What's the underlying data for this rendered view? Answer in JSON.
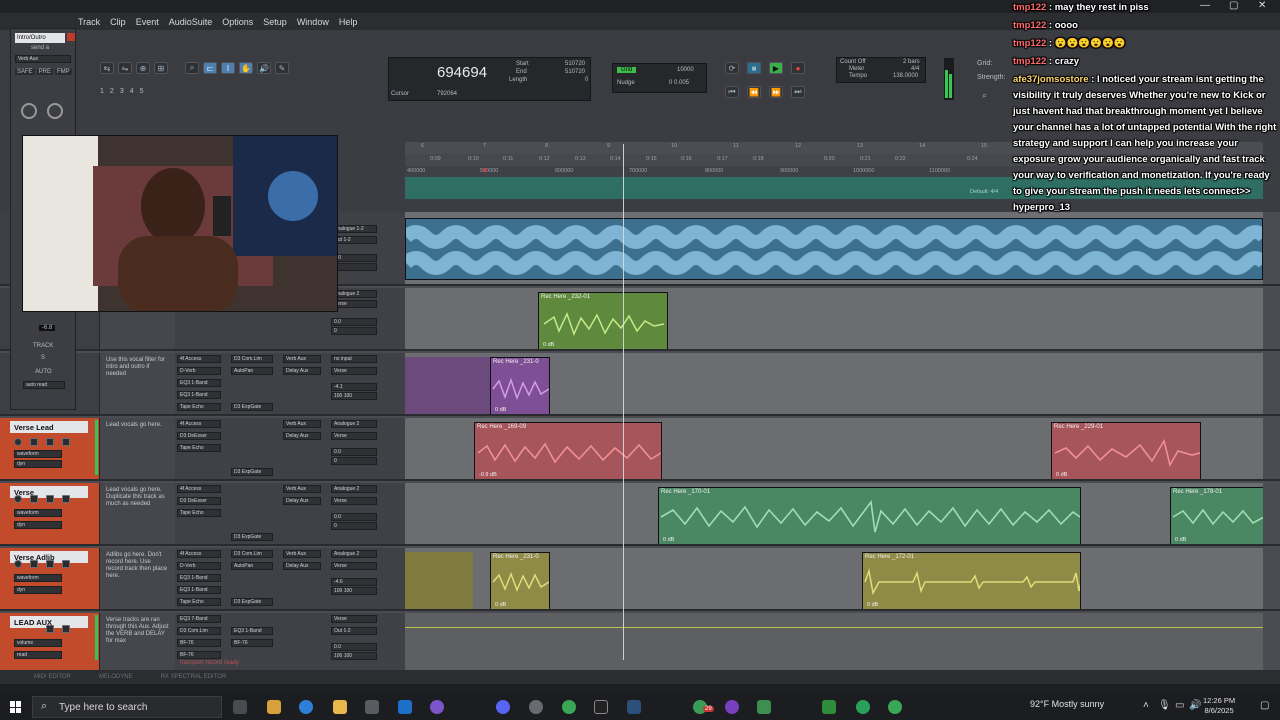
{
  "menu": {
    "items": [
      "Track",
      "Clip",
      "Event",
      "AudioSuite",
      "Options",
      "Setup",
      "Window",
      "Help"
    ]
  },
  "transport": {
    "counter": "694694",
    "start_label": "Start",
    "start_value": "510720",
    "end_label": "End",
    "end_value": "510720",
    "length_label": "Length",
    "length_value": "0",
    "cursor_label": "Cursor",
    "cursor_value": "792064",
    "grid_label": "Grid",
    "grid_value": "10000",
    "nudge_label": "Nudge",
    "nudge_value": "0 0.005",
    "count_off": "Count Off",
    "count_bars": "2 bars",
    "meter_label": "Meter",
    "meter_value": "4/4",
    "tempo_label": "Tempo",
    "tempo_value": "138.0000",
    "grid_right_label": "Grid:",
    "strength_label": "Strength:"
  },
  "ruler": {
    "bars": [
      "6",
      "7",
      "8",
      "9",
      "10",
      "11",
      "12",
      "13",
      "14",
      "15"
    ],
    "times": [
      "0:09",
      "0:10",
      "0:11",
      "0:12",
      "0:13",
      "0:14",
      "0:15",
      "0:16",
      "0:17",
      "0:18",
      "0:20",
      "0:21",
      "0:22",
      "0:24"
    ],
    "samples": [
      "400000",
      "500000",
      "600000",
      "700000",
      "800000",
      "900000",
      "1000000",
      "1100000"
    ],
    "meter_marker": "Default: 4/4"
  },
  "webcam": {
    "description_label": ""
  },
  "mixer_strip": {
    "name": "Intro/Outro",
    "send": "send a",
    "verb": "Verb Aux",
    "safe": "SAFE",
    "pre": "PRE",
    "fmp": "FMP",
    "db": "-6.8",
    "track_label": "TRACK",
    "s_label": "S",
    "auto_label": "AUTO",
    "auto_mode": "auto read"
  },
  "tracks": [
    {
      "name": "",
      "comment": "",
      "vol": "0.0",
      "pan": "0",
      "in": "Analogue 1-2",
      "out": "Out 1-2"
    },
    {
      "name": "",
      "comment": "section you are working on.",
      "vol": "0.0",
      "pan": "0",
      "in": "Analogue 2",
      "out": "Verse"
    },
    {
      "name": "",
      "comment": "Use this vocal filter for intro and outro if needed",
      "vol": "-4.1",
      "pan": "100 100",
      "in": "no input",
      "out": "Verse",
      "plugins": [
        "4f Access",
        "D-Verb",
        "EQ3 1-Band",
        "EQ3 1-Band",
        "Tape Echo"
      ],
      "plugins2": [
        "D3 Com.Lim",
        "AutoPan",
        "",
        "",
        "D3 ExpGate"
      ],
      "sends": [
        "Verb Aux",
        "Delay Aux"
      ]
    },
    {
      "name": "Verse Lead",
      "comment": "Lead vocals go here.",
      "vol": "0.0",
      "pan": "0",
      "in": "Analogue 2",
      "out": "Verse",
      "plugins": [
        "4f Access",
        "D3 DeEsser",
        "Tape Echo",
        "",
        ""
      ],
      "plugins2": [
        "",
        "",
        "",
        "",
        "D3 ExpGate"
      ],
      "sends": [
        "Verb Aux",
        "Delay Aux"
      ],
      "view": "waveform",
      "dyn": "dyn",
      "mode": "read"
    },
    {
      "name": "Verse",
      "comment": "Lead vocals go here. Duplicate this track as much as needed",
      "vol": "0.0",
      "pan": "0",
      "in": "Analogue 2",
      "out": "Verse",
      "plugins": [
        "4f Access",
        "D3 DeEsser",
        "Tape Echo",
        "",
        ""
      ],
      "plugins2": [
        "",
        "",
        "",
        "",
        "D3 ExpGate"
      ],
      "sends": [
        "Verb Aux",
        "Delay Aux"
      ],
      "view": "waveform",
      "dyn": "dyn",
      "mode": "read"
    },
    {
      "name": "Verse Adlib",
      "comment": "Adlibs go here. Don't record here. Use record track then place here.",
      "vol": "-4.6",
      "pan": "100 100",
      "in": "Analogue 2",
      "out": "Verse",
      "plugins": [
        "4f Access",
        "D-Verb",
        "EQ3 1-Band",
        "EQ3 1-Band",
        "Tape Echo"
      ],
      "plugins2": [
        "D3 Com.Lim",
        "AutoPan",
        "",
        "",
        "D3 ExpGate"
      ],
      "sends": [
        "Verb Aux",
        "Delay Aux"
      ],
      "view": "waveform",
      "dyn": "dyn",
      "mode": "read"
    },
    {
      "name": "LEAD AUX",
      "comment": "Verse tracks are ran through this Aux. Adjust the VERB and DELAY for max",
      "vol": "0.0",
      "pan": "100 100",
      "in": "Verse",
      "out": "Out 1-2",
      "plugins": [
        "EQ3 7-Band",
        "D3 Com.Lim",
        "BF-76",
        "BF-76",
        ""
      ],
      "plugins2": [
        "",
        "EQ3 1-Band",
        "BF-76",
        "",
        ""
      ],
      "sends": [],
      "view": "volume",
      "dyn": "",
      "mode": "read"
    }
  ],
  "clips": [
    {
      "label": "Rec Here _232-01",
      "db": "0 dB",
      "color": "#78a44f",
      "wave": "#c7e88b"
    },
    {
      "label": "Rec Here _231-0",
      "db": "0 dB",
      "color": "#8a4fa0",
      "wave": "#d39be6"
    },
    {
      "label": "Rec Here _169-09",
      "db": "-0.9 dB",
      "color": "#b35a5f",
      "wave": "#f08f95"
    },
    {
      "label": "Rec Here _229-01",
      "db": "0 dB",
      "color": "#b35a5f",
      "wave": "#f08f95"
    },
    {
      "label": "Rec Here _170-01",
      "db": "0 dB",
      "color": "#4f8f68",
      "wave": "#9be0b3"
    },
    {
      "label": "Rec Here _178-01",
      "db": "0 dB",
      "color": "#4f8f68",
      "wave": "#9be0b3"
    },
    {
      "label": "Rec Here _231-0",
      "db": "0 dB",
      "color": "#8f8a45",
      "wave": "#e2dc7c"
    },
    {
      "label": "Rec Here _172-01",
      "db": "0 dB",
      "color": "#8f8a45",
      "wave": "#e2dc7c"
    }
  ],
  "chat": [
    {
      "user": "tmp122",
      "text": "may they rest in piss"
    },
    {
      "user": "tmp122",
      "text": "oooo"
    },
    {
      "user": "tmp122",
      "text": "😮😮😮😮😮😮"
    },
    {
      "user": "tmp122",
      "text": "crazy"
    },
    {
      "user": "afe37jomsostore",
      "text": "I noticed your stream isnt getting the visibility it truly deserves Whether you're new to Kick or just havent had that breakthrough moment yet I believe your channel has a lot of untapped potential With the right strategy and support I can help you increase your exposure grow your audience organically and fast track your way to verification and monetization. If you're ready to give your stream the push it needs lets connect>> hyperpro_13"
    }
  ],
  "bottom_tabs": [
    "MIDI EDITOR",
    "MELODYNE",
    "RX SPECTRAL EDITOR"
  ],
  "footer_note": "transport record ready",
  "taskbar": {
    "search_placeholder": "Type here to search",
    "weather": "92°F  Mostly sunny",
    "time": "12:26 PM",
    "date": "8/6/2025",
    "badge": "29"
  }
}
